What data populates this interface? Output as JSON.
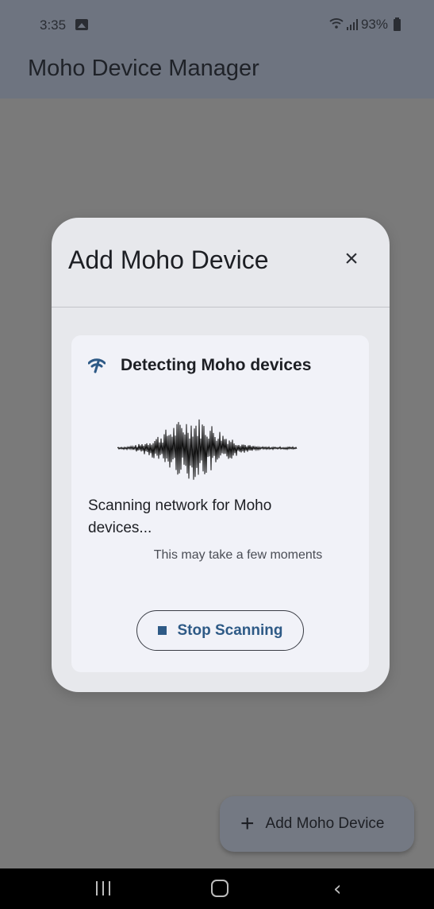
{
  "status_bar": {
    "time": "3:35",
    "battery": "93%",
    "icons": [
      "gallery-icon",
      "wifi-icon",
      "signal-icon",
      "battery-icon"
    ]
  },
  "app_bar": {
    "title": "Moho Device Manager"
  },
  "dialog": {
    "title": "Add Moho Device",
    "close_icon": "×",
    "card": {
      "heading": "Detecting Moho devices",
      "status_text": "Scanning network for Moho devices...",
      "hint": "This may take a few moments",
      "stop_button_label": "Stop Scanning"
    }
  },
  "fab": {
    "icon": "+",
    "label": "Add Moho Device"
  },
  "nav": {
    "back_glyph": "‹"
  },
  "colors": {
    "scrim": "#7a7a7a",
    "app_bar": "#6e7480",
    "dialog_bg": "#e7e8ec",
    "card_bg": "#f1f2f8",
    "accent": "#2e5a86"
  }
}
